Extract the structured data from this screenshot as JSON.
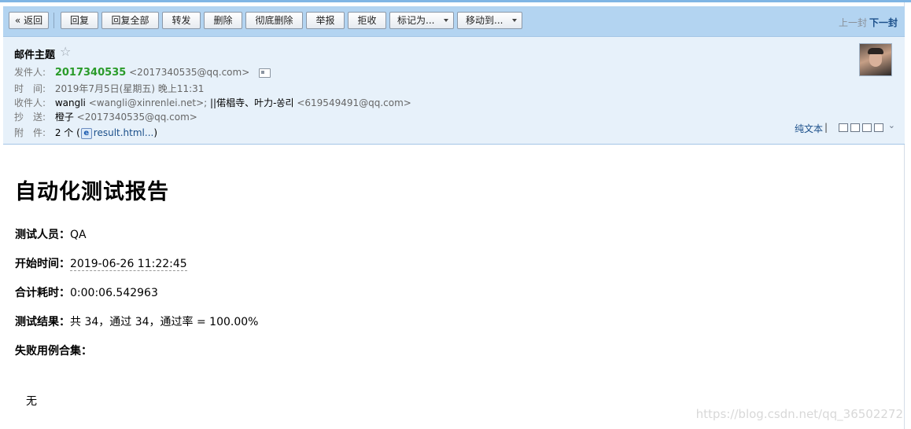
{
  "toolbar": {
    "back": "« 返回",
    "reply": "回复",
    "reply_all": "回复全部",
    "forward": "转发",
    "delete": "删除",
    "delete_permanently": "彻底删除",
    "report": "举报",
    "reject": "拒收",
    "mark_as": "标记为...",
    "move_to": "移动到...",
    "prev": "上一封",
    "next": "下一封"
  },
  "header": {
    "subject": "邮件主题",
    "star": "☆",
    "from_label": "发件人:",
    "from_name": "2017340535",
    "from_email": "<2017340535@qq.com>",
    "time_label": "时　间:",
    "time": "2019年7月5日(星期五) 晚上11:31",
    "to_label": "收件人:",
    "to_name": "wangli",
    "to_email": "<wangli@xinrenlei.net>;",
    "to_name2": "||偌椙寺、叶力-쏭리",
    "to_email2": "<619549491@qq.com>",
    "cc_label": "抄　送:",
    "cc_name": "橙子",
    "cc_email": "<2017340535@qq.com>",
    "attach_label": "附　件:",
    "attach_count": "2 个 (",
    "attach_link": "result.html...",
    "attach_close": ")",
    "plain_text": "纯文本",
    "pipe": "|",
    "expand": "⌄"
  },
  "body": {
    "title": "自动化测试报告",
    "tester_label": "测试人员：",
    "tester": "QA",
    "start_label": "开始时间：",
    "start": "2019-06-26 11:22:45",
    "duration_label": "合计耗时：",
    "duration": "0:00:06.542963",
    "result_label": "测试结果：",
    "result": "共 34，通过 34，通过率 = 100.00%",
    "failed_label": "失败用例合集：",
    "failed_none": "无"
  },
  "watermark": "https://blog.csdn.net/qq_36502272",
  "colors": {
    "toolbar_bg": "#b3d4f1",
    "header_bg": "#e7f1fa",
    "sender_green": "#2a9b2a",
    "link_blue": "#1b4f8a"
  }
}
